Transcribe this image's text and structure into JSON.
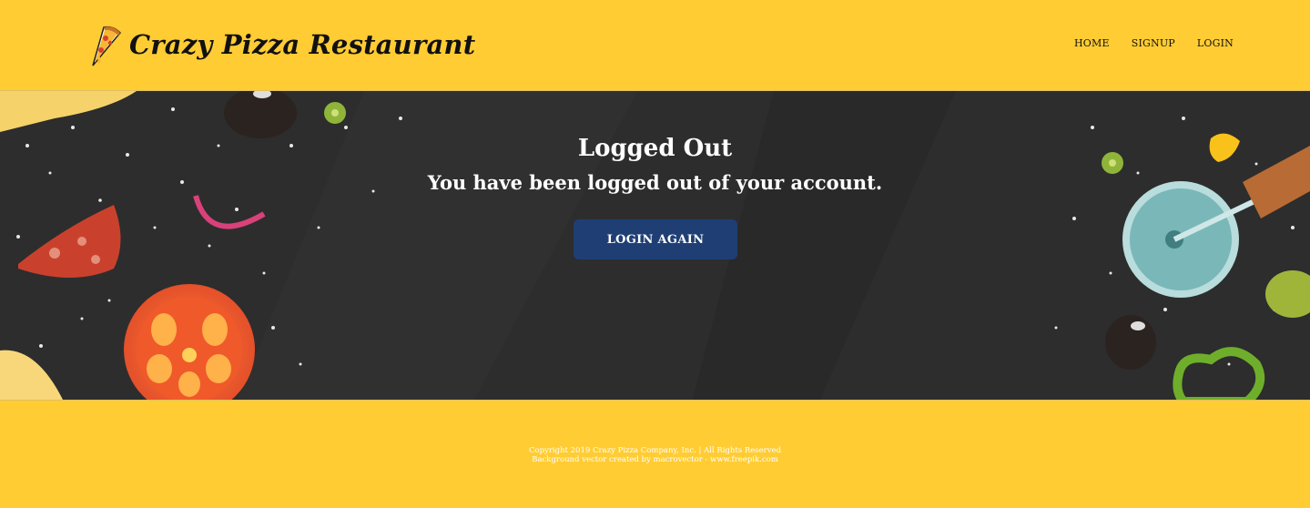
{
  "header": {
    "brand_title": "Crazy Pizza Restaurant",
    "logo_icon": "pizza-slice-icon",
    "nav": [
      {
        "label": "HOME"
      },
      {
        "label": "SIGNUP"
      },
      {
        "label": "LOGIN"
      }
    ]
  },
  "hero": {
    "title": "Logged Out",
    "subtitle": "You have been logged out of your account.",
    "button_label": "LOGIN AGAIN"
  },
  "footer": {
    "copyright": "Copyright 2019 Crazy Pizza Company, Inc. | All Rights Reserved",
    "credit": "Background vector created by macrovector - www.freepik.com"
  },
  "colors": {
    "header_bg": "#ffcc33",
    "hero_bg": "#2c2c2c",
    "button_bg": "#1f3f74",
    "footer_text": "#ffffff"
  }
}
